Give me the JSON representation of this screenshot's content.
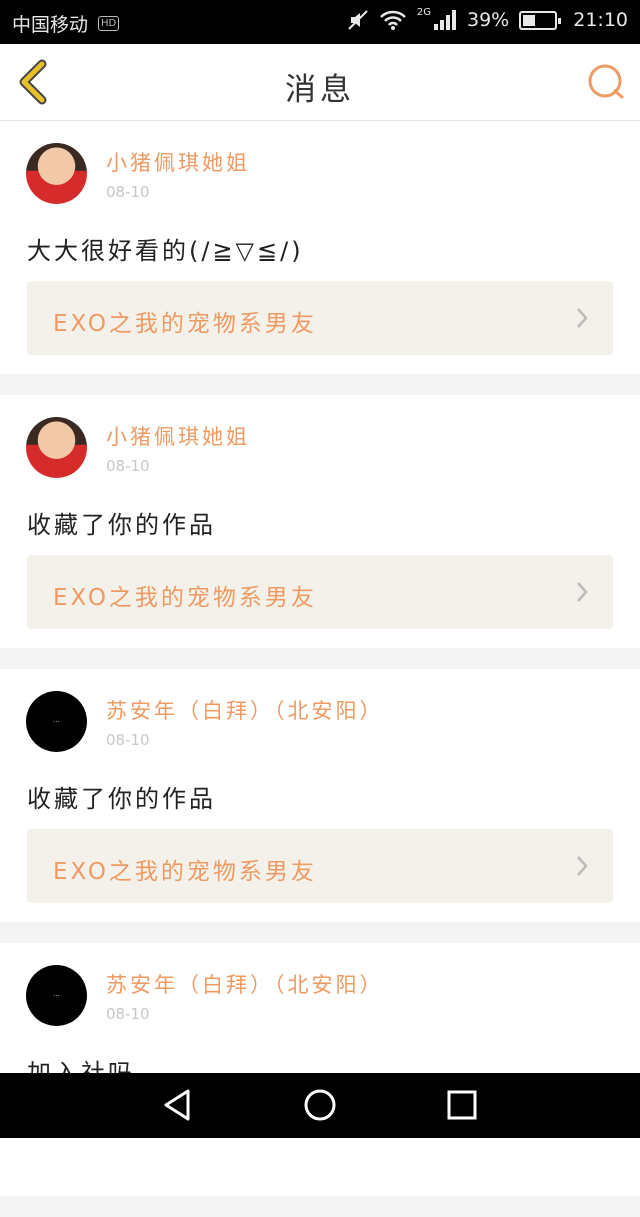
{
  "status_bar": {
    "carrier": "中国移动",
    "hd_badge": "HD",
    "network": "2G",
    "battery_percent": "39%",
    "battery_level": 0.39,
    "time": "21:10"
  },
  "nav": {
    "title": "消息",
    "back_icon": "chevron-left-icon",
    "search_icon": "search-icon"
  },
  "messages": [
    {
      "user": "小猪佩琪她姐",
      "date": "08-10",
      "text": "大大很好看的(/≧▽≦/)",
      "work": "EXO之我的宠物系男友",
      "avatar": "photo"
    },
    {
      "user": "小猪佩琪她姐",
      "date": "08-10",
      "text": "收藏了你的作品",
      "work": "EXO之我的宠物系男友",
      "avatar": "photo"
    },
    {
      "user": "苏安年（白拜）（北安阳）",
      "date": "08-10",
      "text": "收藏了你的作品",
      "work": "EXO之我的宠物系男友",
      "avatar": "dark"
    },
    {
      "user": "苏安年（白拜）（北安阳）",
      "date": "08-10",
      "text": "加入社吗",
      "work": "",
      "avatar": "dark"
    }
  ],
  "colors": {
    "accent": "#f09a63",
    "back_icon": "#e8c02a",
    "link_bg": "#f3f1ea"
  },
  "bottom_nav": {
    "back": "triangle-back-icon",
    "home": "circle-home-icon",
    "recents": "square-recents-icon"
  }
}
